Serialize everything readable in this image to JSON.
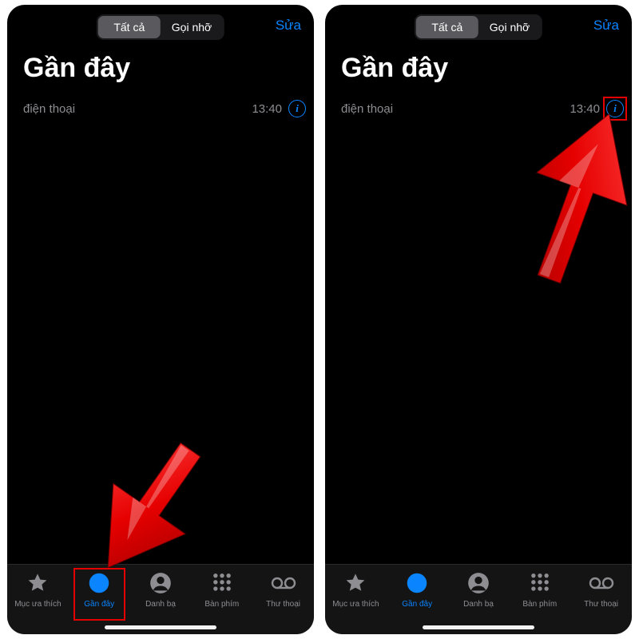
{
  "segment": {
    "all": "Tất cả",
    "missed": "Gọi nhỡ"
  },
  "edit_label": "Sửa",
  "page_title": "Gần đây",
  "call": {
    "name": "điện thoại",
    "time": "13:40"
  },
  "tabs": {
    "fav": "Mục ưa thích",
    "recent": "Gần đây",
    "contacts": "Danh bạ",
    "keypad": "Bàn phím",
    "voicemail": "Thư thoại"
  }
}
